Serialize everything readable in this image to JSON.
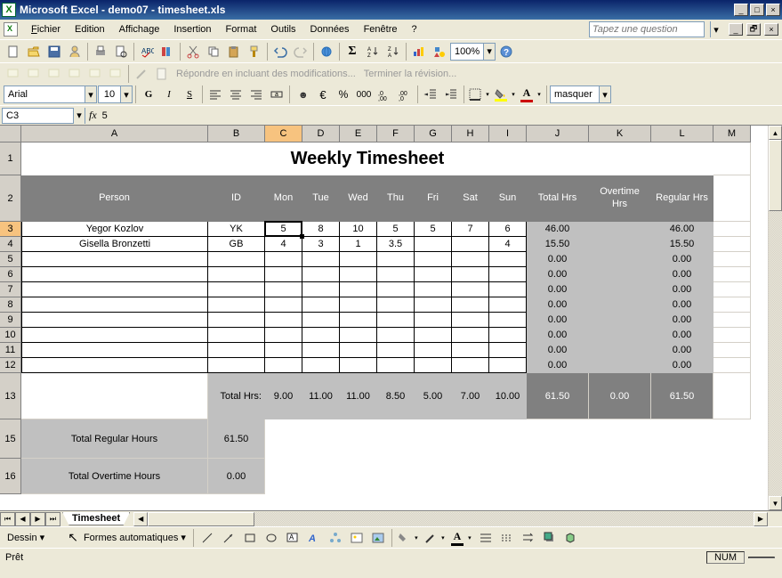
{
  "app": {
    "title": "Microsoft Excel - demo07 - timesheet.xls"
  },
  "menu": {
    "file": "Fichier",
    "edit": "Edition",
    "view": "Affichage",
    "insert": "Insertion",
    "format": "Format",
    "tools": "Outils",
    "data": "Données",
    "window": "Fenêtre",
    "help": "?",
    "ask_placeholder": "Tapez une question"
  },
  "toolbar": {
    "zoom": "100%",
    "reply_txt": "Répondre en incluant des modifications...",
    "end_rev": "Terminer la révision..."
  },
  "format": {
    "font": "Arial",
    "size": "10",
    "mask": "masquer"
  },
  "ref": {
    "cell": "C3",
    "fx": "fx",
    "value": "5"
  },
  "cols": {
    "A": "A",
    "B": "B",
    "C": "C",
    "D": "D",
    "E": "E",
    "F": "F",
    "G": "G",
    "H": "H",
    "I": "I",
    "J": "J",
    "K": "K",
    "L": "L",
    "M": "M"
  },
  "ws": {
    "title": "Weekly Timesheet",
    "hdr": {
      "person": "Person",
      "id": "ID",
      "mon": "Mon",
      "tue": "Tue",
      "wed": "Wed",
      "thu": "Thu",
      "fri": "Fri",
      "sat": "Sat",
      "sun": "Sun",
      "total": "Total Hrs",
      "ot": "Overtime Hrs",
      "reg": "Regular Hrs"
    },
    "rows": [
      {
        "person": "Yegor Kozlov",
        "id": "YK",
        "mon": "5",
        "tue": "8",
        "wed": "10",
        "thu": "5",
        "fri": "5",
        "sat": "7",
        "sun": "6",
        "total": "46.00",
        "ot": "",
        "reg": "46.00"
      },
      {
        "person": "Gisella Bronzetti",
        "id": "GB",
        "mon": "4",
        "tue": "3",
        "wed": "1",
        "thu": "3.5",
        "fri": "",
        "sat": "",
        "sun": "4",
        "total": "15.50",
        "ot": "",
        "reg": "15.50"
      },
      {
        "person": "",
        "id": "",
        "mon": "",
        "tue": "",
        "wed": "",
        "thu": "",
        "fri": "",
        "sat": "",
        "sun": "",
        "total": "0.00",
        "ot": "",
        "reg": "0.00"
      },
      {
        "person": "",
        "id": "",
        "mon": "",
        "tue": "",
        "wed": "",
        "thu": "",
        "fri": "",
        "sat": "",
        "sun": "",
        "total": "0.00",
        "ot": "",
        "reg": "0.00"
      },
      {
        "person": "",
        "id": "",
        "mon": "",
        "tue": "",
        "wed": "",
        "thu": "",
        "fri": "",
        "sat": "",
        "sun": "",
        "total": "0.00",
        "ot": "",
        "reg": "0.00"
      },
      {
        "person": "",
        "id": "",
        "mon": "",
        "tue": "",
        "wed": "",
        "thu": "",
        "fri": "",
        "sat": "",
        "sun": "",
        "total": "0.00",
        "ot": "",
        "reg": "0.00"
      },
      {
        "person": "",
        "id": "",
        "mon": "",
        "tue": "",
        "wed": "",
        "thu": "",
        "fri": "",
        "sat": "",
        "sun": "",
        "total": "0.00",
        "ot": "",
        "reg": "0.00"
      },
      {
        "person": "",
        "id": "",
        "mon": "",
        "tue": "",
        "wed": "",
        "thu": "",
        "fri": "",
        "sat": "",
        "sun": "",
        "total": "0.00",
        "ot": "",
        "reg": "0.00"
      },
      {
        "person": "",
        "id": "",
        "mon": "",
        "tue": "",
        "wed": "",
        "thu": "",
        "fri": "",
        "sat": "",
        "sun": "",
        "total": "0.00",
        "ot": "",
        "reg": "0.00"
      },
      {
        "person": "",
        "id": "",
        "mon": "",
        "tue": "",
        "wed": "",
        "thu": "",
        "fri": "",
        "sat": "",
        "sun": "",
        "total": "0.00",
        "ot": "",
        "reg": "0.00"
      }
    ],
    "totals_label": "Total Hrs:",
    "totals": {
      "mon": "9.00",
      "tue": "11.00",
      "wed": "11.00",
      "thu": "8.50",
      "fri": "5.00",
      "sat": "7.00",
      "sun": "10.00",
      "total": "61.50",
      "ot": "0.00",
      "reg": "61.50"
    },
    "summary": {
      "reg_label": "Total Regular Hours",
      "reg_val": "61.50",
      "ot_label": "Total Overtime Hours",
      "ot_val": "0.00"
    }
  },
  "tabs": {
    "sheet1": "Timesheet"
  },
  "draw": {
    "label": "Dessin",
    "autoshapes": "Formes automatiques"
  },
  "status": {
    "ready": "Prêt",
    "num": "NUM"
  },
  "rownums": [
    "1",
    "2",
    "3",
    "4",
    "5",
    "6",
    "7",
    "8",
    "9",
    "10",
    "11",
    "12",
    "13",
    "15",
    "16"
  ]
}
